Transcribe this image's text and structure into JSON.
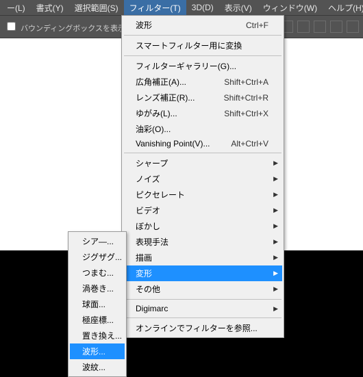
{
  "menubar": {
    "items": [
      {
        "label": "ー(L)"
      },
      {
        "label": "書式(Y)"
      },
      {
        "label": "選択範囲(S)"
      },
      {
        "label": "フィルター(T)"
      },
      {
        "label": "3D(D)"
      },
      {
        "label": "表示(V)"
      },
      {
        "label": "ウィンドウ(W)"
      },
      {
        "label": "ヘルプ(H)"
      }
    ]
  },
  "optionsbar": {
    "bounding_label": "バウンディングボックスを表示"
  },
  "filter_menu": {
    "last": {
      "label": "波形",
      "shortcut": "Ctrl+F"
    },
    "smart": {
      "label": "スマートフィルター用に変換"
    },
    "gallery": {
      "label": "フィルターギャラリー(G)..."
    },
    "wide": {
      "label": "広角補正(A)...",
      "shortcut": "Shift+Ctrl+A"
    },
    "lens": {
      "label": "レンズ補正(R)...",
      "shortcut": "Shift+Ctrl+R"
    },
    "liquify": {
      "label": "ゆがみ(L)...",
      "shortcut": "Shift+Ctrl+X"
    },
    "oil": {
      "label": "油彩(O)..."
    },
    "vanish": {
      "label": "Vanishing Point(V)...",
      "shortcut": "Alt+Ctrl+V"
    },
    "sharpen": {
      "label": "シャープ"
    },
    "noise": {
      "label": "ノイズ"
    },
    "pixelate": {
      "label": "ピクセレート"
    },
    "video": {
      "label": "ビデオ"
    },
    "blur": {
      "label": "ぼかし"
    },
    "render": {
      "label": "表現手法"
    },
    "sketch": {
      "label": "描画"
    },
    "distort": {
      "label": "変形"
    },
    "other": {
      "label": "その他"
    },
    "digimarc": {
      "label": "Digimarc"
    },
    "browse": {
      "label": "オンラインでフィルターを参照..."
    }
  },
  "distort_submenu": {
    "shear": {
      "label": "シア—..."
    },
    "zigzag": {
      "label": "ジグザグ..."
    },
    "pinch": {
      "label": "つまむ..."
    },
    "twirl": {
      "label": "渦巻き..."
    },
    "spherize": {
      "label": "球面..."
    },
    "polar": {
      "label": "極座標..."
    },
    "displace": {
      "label": "置き換え..."
    },
    "wave": {
      "label": "波形..."
    },
    "ripple": {
      "label": "波紋..."
    }
  }
}
